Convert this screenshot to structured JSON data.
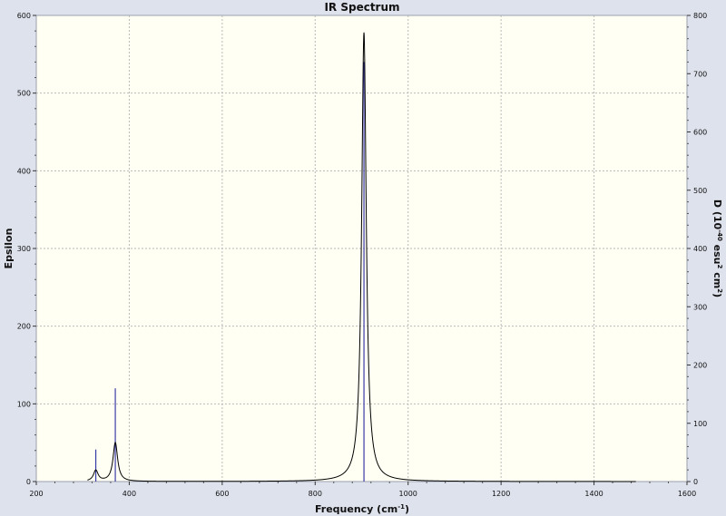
{
  "chart_data": {
    "type": "line",
    "title": "IR Spectrum",
    "xlabel": "Frequency (cm",
    "xlabel_sup": "-1",
    "xlabel_tail": ")",
    "ylabel": "Epsilon",
    "y2label": {
      "p1": "D (10",
      "s1": "-40",
      "p2": " esu",
      "s2": "2",
      "p3": " cm",
      "s3": "2",
      "p4": ")"
    },
    "xlim": [
      200,
      1600
    ],
    "ylim": [
      0,
      600
    ],
    "y2lim": [
      0,
      800
    ],
    "xticks": [
      200,
      400,
      600,
      800,
      1000,
      1200,
      1400,
      1600
    ],
    "yticks": [
      0,
      100,
      200,
      300,
      400,
      500,
      600
    ],
    "y2ticks": [
      0,
      100,
      200,
      300,
      400,
      500,
      600,
      700,
      800
    ],
    "grid": true,
    "curve_range": [
      310,
      1490
    ],
    "curve_width_cm": 6,
    "peaks": [
      {
        "x": 328,
        "y": 14
      },
      {
        "x": 370,
        "y": 50
      },
      {
        "x": 905,
        "y": 578
      }
    ],
    "stick_series": [
      {
        "x": 328,
        "d": 55
      },
      {
        "x": 370,
        "d": 160
      },
      {
        "x": 905,
        "d": 720
      }
    ],
    "colors": {
      "background": "#dee2ed",
      "plot_bg": "#fffff4",
      "curve": "#000000",
      "sticks": "#3a3aa8",
      "grid": "#b9b9b9"
    }
  }
}
